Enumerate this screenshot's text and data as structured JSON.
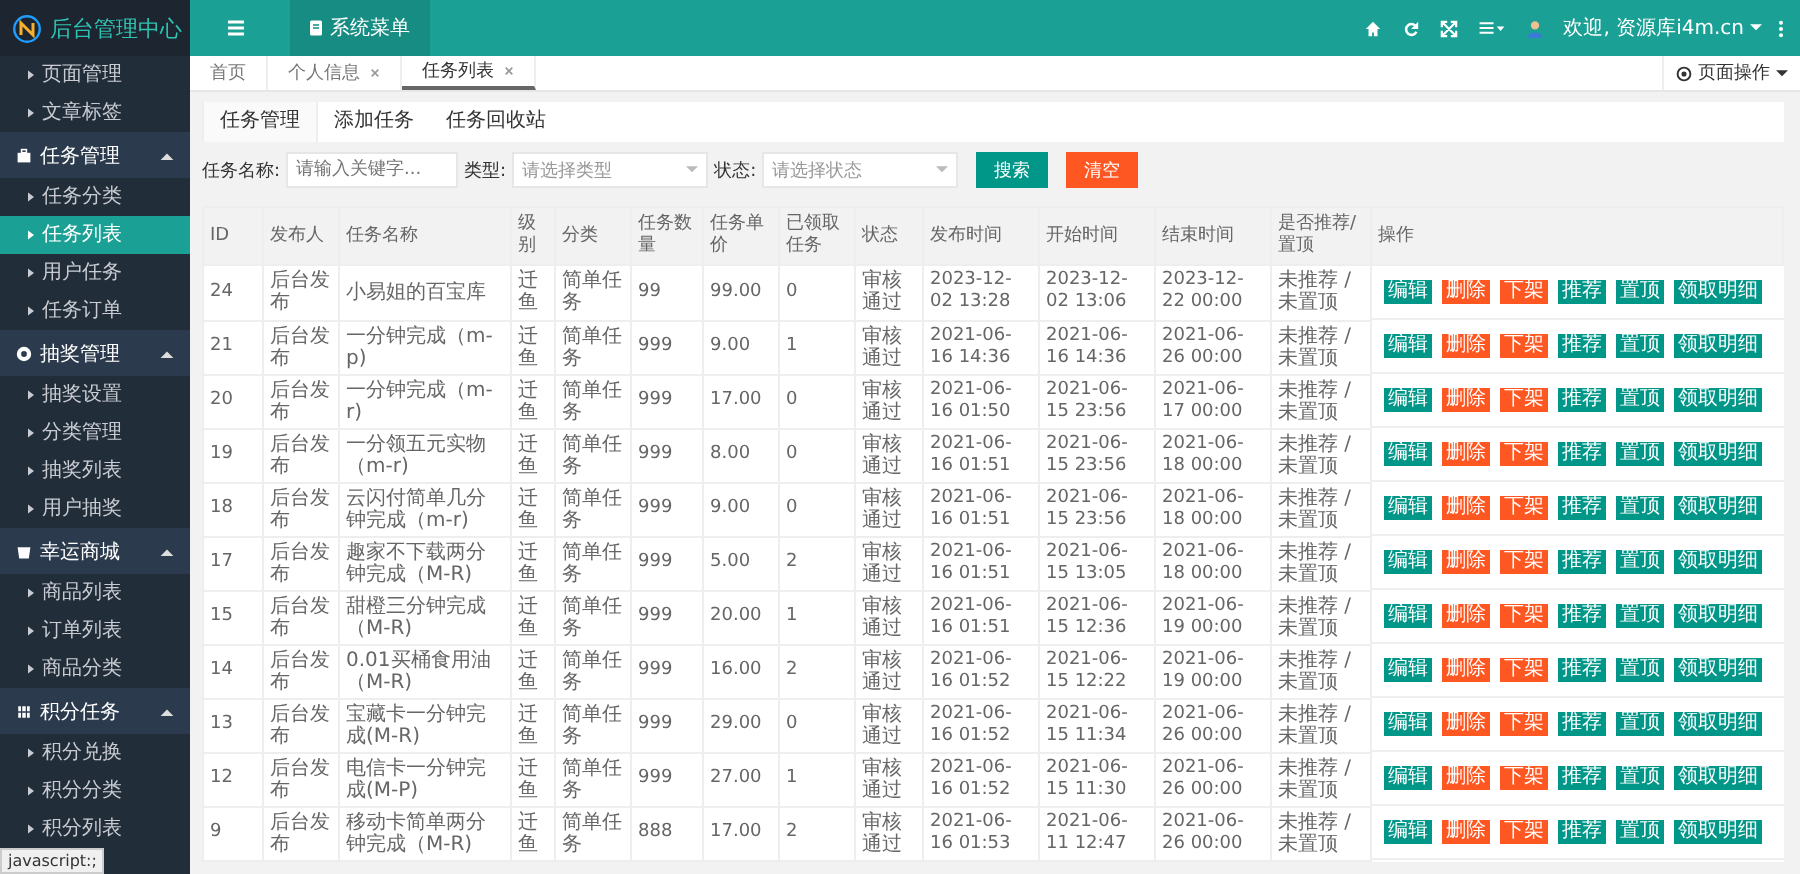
{
  "app_title": "后台管理中心",
  "sidebar": {
    "top_items": [
      {
        "label": "页面管理",
        "selected": false
      },
      {
        "label": "文章标签",
        "selected": false
      }
    ],
    "groups": [
      {
        "label": "任务管理",
        "expanded": true,
        "items": [
          {
            "label": "任务分类",
            "selected": false
          },
          {
            "label": "任务列表",
            "selected": true
          },
          {
            "label": "用户任务",
            "selected": false
          },
          {
            "label": "任务订单",
            "selected": false
          }
        ]
      },
      {
        "label": "抽奖管理",
        "expanded": true,
        "items": [
          {
            "label": "抽奖设置",
            "selected": false
          },
          {
            "label": "分类管理",
            "selected": false
          },
          {
            "label": "抽奖列表",
            "selected": false
          },
          {
            "label": "用户抽奖",
            "selected": false
          }
        ]
      },
      {
        "label": "幸运商城",
        "expanded": true,
        "items": [
          {
            "label": "商品列表",
            "selected": false
          },
          {
            "label": "订单列表",
            "selected": false
          },
          {
            "label": "商品分类",
            "selected": false
          }
        ]
      },
      {
        "label": "积分任务",
        "expanded": true,
        "items": [
          {
            "label": "积分兑换",
            "selected": false
          },
          {
            "label": "积分分类",
            "selected": false
          },
          {
            "label": "积分列表",
            "selected": false
          }
        ]
      }
    ]
  },
  "topbar": {
    "menu_tab": "系统菜单",
    "user": "欢迎, 资源库i4m.cn"
  },
  "page_tabs": [
    {
      "label": "首页",
      "closable": false,
      "selected": false
    },
    {
      "label": "个人信息",
      "closable": true,
      "selected": false
    },
    {
      "label": "任务列表",
      "closable": true,
      "selected": true
    }
  ],
  "page_actions": "页面操作",
  "sub_tabs": [
    {
      "label": "任务管理",
      "selected": true
    },
    {
      "label": "添加任务",
      "selected": false
    },
    {
      "label": "任务回收站",
      "selected": false
    }
  ],
  "filters": {
    "name_label": "任务名称:",
    "name_placeholder": "请输入关键字...",
    "type_label": "类型:",
    "type_placeholder": "请选择类型",
    "status_label": "状态:",
    "status_placeholder": "请选择状态",
    "search_button": "搜索",
    "clear_button": "清空"
  },
  "table": {
    "columns": [
      "ID",
      "发布人",
      "任务名称",
      "级别",
      "分类",
      "任务数量",
      "任务单价",
      "已领取任务",
      "状态",
      "发布时间",
      "开始时间",
      "结束时间",
      "是否推荐/置顶",
      "操作"
    ],
    "rows": [
      {
        "cells": [
          "24",
          "后台发布",
          "小易姐的百宝库",
          "迁鱼",
          "简单任务",
          "99",
          "99.00",
          "0",
          "审核通过",
          "2023-12-02 13:28",
          "2023-12-02 13:06",
          "2023-12-22 00:00",
          "未推荐 / 未置顶"
        ],
        "actions": [
          {
            "label": "编辑",
            "kind": "normal"
          },
          {
            "label": "删除",
            "kind": "warn"
          },
          {
            "label": "下架",
            "kind": "warn"
          },
          {
            "label": "推荐",
            "kind": "normal"
          },
          {
            "label": "置顶",
            "kind": "normal"
          },
          {
            "label": "领取明细",
            "kind": "normal"
          }
        ]
      },
      {
        "cells": [
          "21",
          "后台发布",
          "一分钟完成（m-p)",
          "迁鱼",
          "简单任务",
          "999",
          "9.00",
          "1",
          "审核通过",
          "2021-06-16 14:36",
          "2021-06-16 14:36",
          "2021-06-26 00:00",
          "未推荐 / 未置顶"
        ],
        "actions": [
          {
            "label": "编辑",
            "kind": "normal"
          },
          {
            "label": "删除",
            "kind": "warn"
          },
          {
            "label": "下架",
            "kind": "warn"
          },
          {
            "label": "推荐",
            "kind": "normal"
          },
          {
            "label": "置顶",
            "kind": "normal"
          },
          {
            "label": "领取明细",
            "kind": "normal"
          }
        ]
      },
      {
        "cells": [
          "20",
          "后台发布",
          "一分钟完成（m-r)",
          "迁鱼",
          "简单任务",
          "999",
          "17.00",
          "0",
          "审核通过",
          "2021-06-16 01:50",
          "2021-06-15 23:56",
          "2021-06-17 00:00",
          "未推荐 / 未置顶"
        ],
        "actions": [
          {
            "label": "编辑",
            "kind": "normal"
          },
          {
            "label": "删除",
            "kind": "warn"
          },
          {
            "label": "下架",
            "kind": "warn"
          },
          {
            "label": "推荐",
            "kind": "normal"
          },
          {
            "label": "置顶",
            "kind": "normal"
          },
          {
            "label": "领取明细",
            "kind": "normal"
          }
        ]
      },
      {
        "cells": [
          "19",
          "后台发布",
          "一分领五元实物（m-r)",
          "迁鱼",
          "简单任务",
          "999",
          "8.00",
          "0",
          "审核通过",
          "2021-06-16 01:51",
          "2021-06-15 23:56",
          "2021-06-18 00:00",
          "未推荐 / 未置顶"
        ],
        "actions": [
          {
            "label": "编辑",
            "kind": "normal"
          },
          {
            "label": "删除",
            "kind": "warn"
          },
          {
            "label": "下架",
            "kind": "warn"
          },
          {
            "label": "推荐",
            "kind": "normal"
          },
          {
            "label": "置顶",
            "kind": "normal"
          },
          {
            "label": "领取明细",
            "kind": "normal"
          }
        ]
      },
      {
        "cells": [
          "18",
          "后台发布",
          "云闪付简单几分钟完成（m-r)",
          "迁鱼",
          "简单任务",
          "999",
          "9.00",
          "0",
          "审核通过",
          "2021-06-16 01:51",
          "2021-06-15 23:56",
          "2021-06-18 00:00",
          "未推荐 / 未置顶"
        ],
        "actions": [
          {
            "label": "编辑",
            "kind": "normal"
          },
          {
            "label": "删除",
            "kind": "warn"
          },
          {
            "label": "下架",
            "kind": "warn"
          },
          {
            "label": "推荐",
            "kind": "normal"
          },
          {
            "label": "置顶",
            "kind": "normal"
          },
          {
            "label": "领取明细",
            "kind": "normal"
          }
        ]
      },
      {
        "cells": [
          "17",
          "后台发布",
          "趣家不下载两分钟完成（M-R)",
          "迁鱼",
          "简单任务",
          "999",
          "5.00",
          "2",
          "审核通过",
          "2021-06-16 01:51",
          "2021-06-15 13:05",
          "2021-06-18 00:00",
          "未推荐 / 未置顶"
        ],
        "actions": [
          {
            "label": "编辑",
            "kind": "normal"
          },
          {
            "label": "删除",
            "kind": "warn"
          },
          {
            "label": "下架",
            "kind": "warn"
          },
          {
            "label": "推荐",
            "kind": "normal"
          },
          {
            "label": "置顶",
            "kind": "normal"
          },
          {
            "label": "领取明细",
            "kind": "normal"
          }
        ]
      },
      {
        "cells": [
          "15",
          "后台发布",
          "甜橙三分钟完成（M-R)",
          "迁鱼",
          "简单任务",
          "999",
          "20.00",
          "1",
          "审核通过",
          "2021-06-16 01:51",
          "2021-06-15 12:36",
          "2021-06-19 00:00",
          "未推荐 / 未置顶"
        ],
        "actions": [
          {
            "label": "编辑",
            "kind": "normal"
          },
          {
            "label": "删除",
            "kind": "warn"
          },
          {
            "label": "下架",
            "kind": "warn"
          },
          {
            "label": "推荐",
            "kind": "normal"
          },
          {
            "label": "置顶",
            "kind": "normal"
          },
          {
            "label": "领取明细",
            "kind": "normal"
          }
        ]
      },
      {
        "cells": [
          "14",
          "后台发布",
          "0.01买桶食用油（M-R)",
          "迁鱼",
          "简单任务",
          "999",
          "16.00",
          "2",
          "审核通过",
          "2021-06-16 01:52",
          "2021-06-15 12:22",
          "2021-06-19 00:00",
          "未推荐 / 未置顶"
        ],
        "actions": [
          {
            "label": "编辑",
            "kind": "normal"
          },
          {
            "label": "删除",
            "kind": "warn"
          },
          {
            "label": "下架",
            "kind": "warn"
          },
          {
            "label": "推荐",
            "kind": "normal"
          },
          {
            "label": "置顶",
            "kind": "normal"
          },
          {
            "label": "领取明细",
            "kind": "normal"
          }
        ]
      },
      {
        "cells": [
          "13",
          "后台发布",
          "宝藏卡一分钟完成(M-R)",
          "迁鱼",
          "简单任务",
          "999",
          "29.00",
          "0",
          "审核通过",
          "2021-06-16 01:52",
          "2021-06-15 11:34",
          "2021-06-26 00:00",
          "未推荐 / 未置顶"
        ],
        "actions": [
          {
            "label": "编辑",
            "kind": "normal"
          },
          {
            "label": "删除",
            "kind": "warn"
          },
          {
            "label": "下架",
            "kind": "warn"
          },
          {
            "label": "推荐",
            "kind": "normal"
          },
          {
            "label": "置顶",
            "kind": "normal"
          },
          {
            "label": "领取明细",
            "kind": "normal"
          }
        ]
      },
      {
        "cells": [
          "12",
          "后台发布",
          "电信卡一分钟完成(M-P)",
          "迁鱼",
          "简单任务",
          "999",
          "27.00",
          "1",
          "审核通过",
          "2021-06-16 01:52",
          "2021-06-15 11:30",
          "2021-06-26 00:00",
          "未推荐 / 未置顶"
        ],
        "actions": [
          {
            "label": "编辑",
            "kind": "normal"
          },
          {
            "label": "删除",
            "kind": "warn"
          },
          {
            "label": "下架",
            "kind": "warn"
          },
          {
            "label": "推荐",
            "kind": "normal"
          },
          {
            "label": "置顶",
            "kind": "normal"
          },
          {
            "label": "领取明细",
            "kind": "normal"
          }
        ]
      },
      {
        "cells": [
          "9",
          "后台发布",
          "移动卡简单两分钟完成（M-R)",
          "迁鱼",
          "简单任务",
          "888",
          "17.00",
          "2",
          "审核通过",
          "2021-06-16 01:53",
          "2021-06-11 12:47",
          "2021-06-26 00:00",
          "未推荐 / 未置顶"
        ],
        "actions": [
          {
            "label": "编辑",
            "kind": "normal"
          },
          {
            "label": "删除",
            "kind": "warn"
          },
          {
            "label": "下架",
            "kind": "warn"
          },
          {
            "label": "推荐",
            "kind": "normal"
          },
          {
            "label": "置顶",
            "kind": "normal"
          },
          {
            "label": "领取明细",
            "kind": "normal"
          }
        ]
      }
    ]
  },
  "status_link": "javascript:;"
}
